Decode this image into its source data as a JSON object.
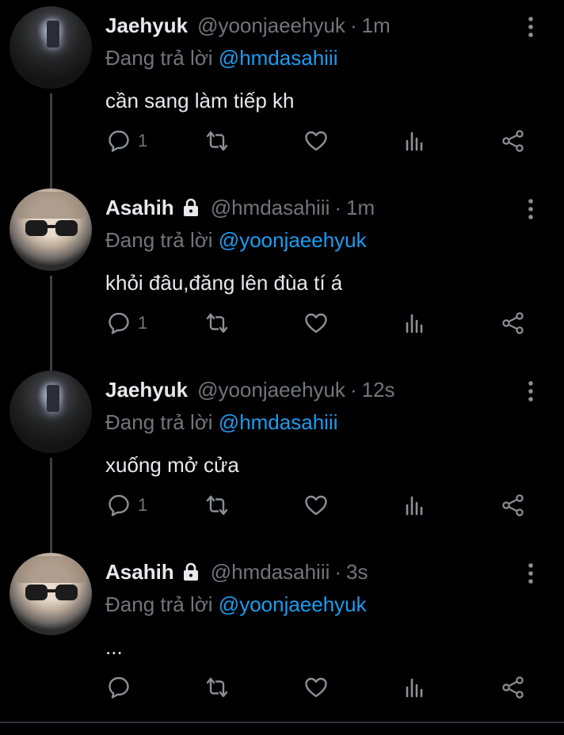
{
  "colors": {
    "background": "#000000",
    "text": "#e7e9ea",
    "muted": "#71767b",
    "mention": "#1d9bf0",
    "thread_line": "#3a3f44"
  },
  "reply_prefix": "Đang trả lời",
  "tweets": [
    {
      "name": "Jaehyuk",
      "handle": "@yoonjaeehyuk",
      "sep": "·",
      "time": "1m",
      "reply_to": "@hmdasahiii",
      "text": "cần sang làm tiếp kh",
      "reply_count": "1",
      "protected": false
    },
    {
      "name": "Asahih",
      "handle": "@hmdasahiii",
      "sep": "·",
      "time": "1m",
      "reply_to": "@yoonjaeehyuk",
      "text": "khỏi đâu,đăng lên đùa tí á",
      "reply_count": "1",
      "protected": true
    },
    {
      "name": "Jaehyuk",
      "handle": "@yoonjaeehyuk",
      "sep": "·",
      "time": "12s",
      "reply_to": "@hmdasahiii",
      "text": "xuống mở cửa",
      "reply_count": "1",
      "protected": false
    },
    {
      "name": "Asahih",
      "handle": "@hmdasahiii",
      "sep": "·",
      "time": "3s",
      "reply_to": "@yoonjaeehyuk",
      "text": "...",
      "reply_count": "",
      "protected": true
    }
  ],
  "icons": {
    "reply": "reply-icon",
    "retweet": "retweet-icon",
    "like": "heart-icon",
    "views": "analytics-icon",
    "share": "share-icon",
    "more": "more-vertical-icon",
    "lock": "lock-icon"
  }
}
